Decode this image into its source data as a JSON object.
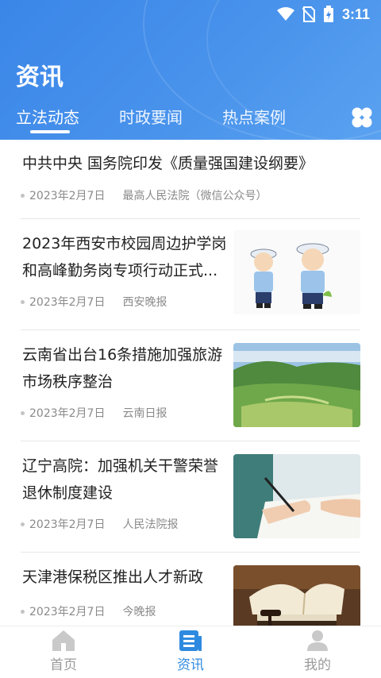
{
  "status_bar": {
    "time": "3:11"
  },
  "header": {
    "title": "资讯"
  },
  "tabs": [
    {
      "label": "立法动态",
      "active": true
    },
    {
      "label": "时政要闻",
      "active": false
    },
    {
      "label": "热点案例",
      "active": false
    }
  ],
  "news": [
    {
      "title_line1": "中共中央 国务院印发《质量强国建设纲要》",
      "title_line2": "",
      "date": "2023年2月7日",
      "source": "最高人民法院（微信公众号）",
      "thumb": ""
    },
    {
      "title_line1": "2023年西安市校园周边护学岗",
      "title_line2": "和高峰勤务岗专项行动正式...",
      "date": "2023年2月7日",
      "source": "西安晚报",
      "thumb": "police-cartoon-image"
    },
    {
      "title_line1": "云南省出台16条措施加强旅游",
      "title_line2": "市场秩序整治",
      "date": "2023年2月7日",
      "source": "云南日报",
      "thumb": "landscape-image"
    },
    {
      "title_line1": "辽宁高院：加强机关干警荣誉",
      "title_line2": "退休制度建设",
      "date": "2023年2月7日",
      "source": "人民法院报",
      "thumb": "writing-hand-image"
    },
    {
      "title_line1": "天津港保税区推出人才新政",
      "title_line2": "",
      "date": "2023年2月7日",
      "source": "今晚报",
      "thumb": "books-gavel-image"
    }
  ],
  "bottom_nav": [
    {
      "label": "首页",
      "icon": "home-icon",
      "active": false
    },
    {
      "label": "资讯",
      "icon": "news-icon",
      "active": true
    },
    {
      "label": "我的",
      "icon": "profile-icon",
      "active": false
    }
  ],
  "colors": {
    "accent": "#3a86e8",
    "nav_active": "#2e8ae0",
    "nav_inactive": "#9a9a9a"
  }
}
